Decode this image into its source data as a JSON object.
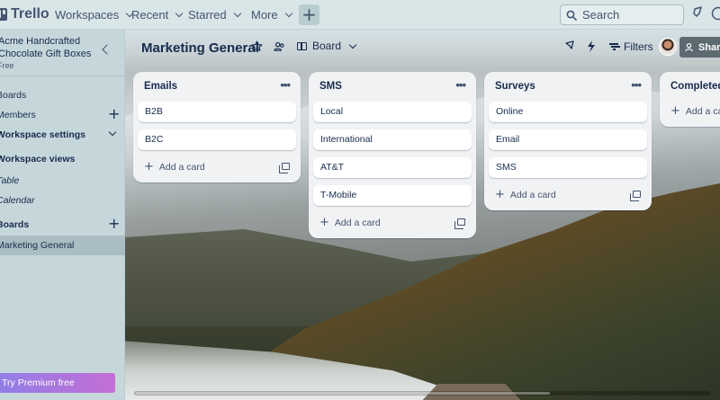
{
  "app": {
    "name": "Trello",
    "nav": [
      "Workspaces",
      "Recent",
      "Starred",
      "More"
    ],
    "search_placeholder": "Search"
  },
  "sidebar": {
    "workspace_name": "Acme Handcrafted Chocolate Gift Boxes",
    "workspace_plan": "Free",
    "items": {
      "boards": "Boards",
      "members": "Members",
      "workspace_settings": "Workspace settings",
      "workspace_views": "Workspace views",
      "table": "Table",
      "calendar": "Calendar",
      "your_boards": "Boards",
      "active_board": "Marketing General"
    },
    "premium": "Try Premium free"
  },
  "board": {
    "title": "Marketing General",
    "view": "Board",
    "filters": "Filters",
    "share": "Share",
    "lists": [
      {
        "title": "Emails",
        "cards": [
          "B2B",
          "B2C"
        ],
        "add_label": "Add a card"
      },
      {
        "title": "SMS",
        "cards": [
          "Local",
          "International",
          "AT&T",
          "T-Mobile"
        ],
        "add_label": "Add a card"
      },
      {
        "title": "Surveys",
        "cards": [
          "Online",
          "Email",
          "SMS"
        ],
        "add_label": "Add a card"
      },
      {
        "title": "Completed",
        "cards": [],
        "add_label": "Add a card"
      }
    ]
  },
  "colors": {
    "topbar": "#d9e6e8",
    "sidebar": "#c6d7db",
    "list_bg": "#f1f2f4",
    "share_button": "#5e6a72",
    "premium_gradient_start": "#8f7ee7",
    "premium_gradient_end": "#c46ed6"
  }
}
